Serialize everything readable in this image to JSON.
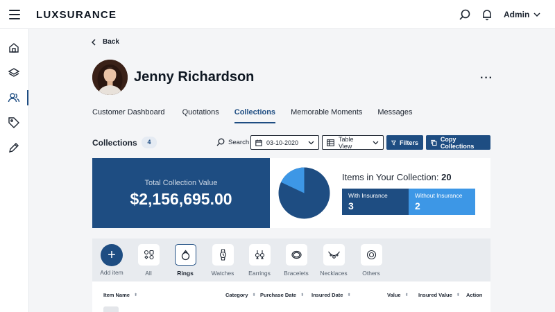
{
  "header": {
    "logo": "LUXSURANCE",
    "user": "Admin"
  },
  "nav": {
    "back": "Back"
  },
  "profile": {
    "name": "Jenny Richardson"
  },
  "tabs": [
    {
      "label": "Customer Dashboard"
    },
    {
      "label": "Quotations"
    },
    {
      "label": "Collections",
      "active": true
    },
    {
      "label": "Memorable Moments"
    },
    {
      "label": "Messages"
    }
  ],
  "collections": {
    "title": "Collections",
    "count": "4",
    "search_label": "Search",
    "date": "03-10-2020",
    "view": "Table View",
    "filters_label": "Filters",
    "copy_label": "Copy Collections"
  },
  "summary": {
    "total_label": "Total Collection Value",
    "total_value": "$2,156,695.00",
    "items_label": "Items in Your Collection:",
    "items_count": "20",
    "with_insurance_label": "With Insurance",
    "with_insurance_value": "3",
    "without_insurance_label": "Without Insurance",
    "without_insurance_value": "2"
  },
  "pie_share": {
    "with_insurance": 0.82,
    "without_insurance": 0.18
  },
  "categories": [
    {
      "label": "Add item",
      "icon": "plus-icon"
    },
    {
      "label": "All",
      "icon": "all-items-icon"
    },
    {
      "label": "Rings",
      "icon": "ring-icon",
      "selected": true
    },
    {
      "label": "Watches",
      "icon": "watch-icon"
    },
    {
      "label": "Earrings",
      "icon": "earring-icon"
    },
    {
      "label": "Bracelets",
      "icon": "bracelet-icon"
    },
    {
      "label": "Necklaces",
      "icon": "necklace-icon"
    },
    {
      "label": "Others",
      "icon": "gem-icon"
    }
  ],
  "table": {
    "columns": [
      "Item Name",
      "Category",
      "Purchase Date",
      "Insured Date",
      "Value",
      "Insured Value",
      "Action"
    ]
  },
  "colors": {
    "primary": "#1e4d82",
    "accent": "#3d97e6",
    "sidebar_active": "#1e4d82"
  }
}
